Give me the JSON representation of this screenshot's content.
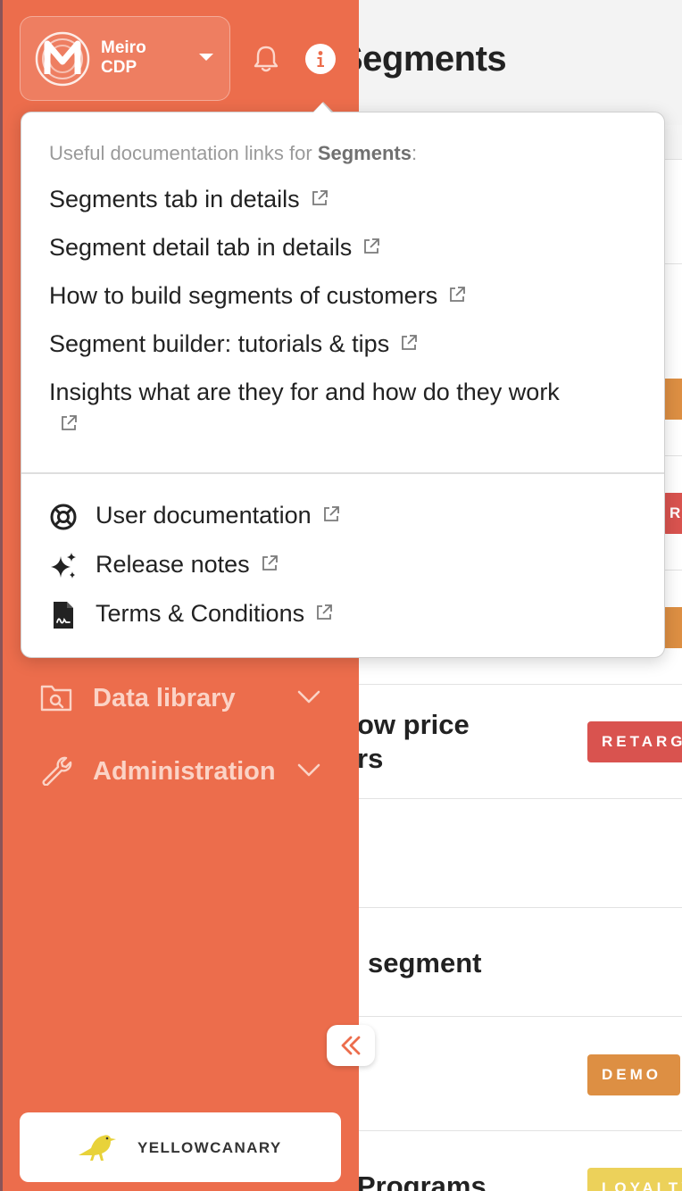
{
  "brand": {
    "name_line1": "Meiro",
    "name_line2": "CDP"
  },
  "main": {
    "page_title": "Segments",
    "rows": [
      {
        "title_line1": "ow price",
        "title_line2": "rs",
        "tag": "RETARGETING",
        "tag_color": "#d9534f"
      },
      {
        "title_line1": "segment"
      },
      {
        "tag": "DEMO",
        "tag_color": "#dd8f43"
      },
      {
        "title_line1": "Programs",
        "tag": "LOYALTY",
        "tag_color": "#ecd15a"
      }
    ],
    "partial_tags": [
      {
        "tag": "",
        "tag_color": "#dd8f43"
      },
      {
        "tag": "RG",
        "tag_color": "#d9534f"
      },
      {
        "tag": "",
        "tag_color": "#dd8f43"
      }
    ]
  },
  "popover": {
    "intro_prefix": "Useful documentation links for ",
    "intro_bold": "Segments",
    "intro_suffix": ":",
    "links": [
      "Segments tab in details",
      "Segment detail tab in details",
      "How to build segments of customers",
      "Segment builder: tutorials & tips",
      "Insights what are they for and how do they work"
    ],
    "bottom_links": [
      {
        "label": "User documentation",
        "icon": "lifebuoy-icon"
      },
      {
        "label": "Release notes",
        "icon": "sparkles-icon"
      },
      {
        "label": "Terms & Conditions",
        "icon": "file-contract-icon"
      }
    ]
  },
  "nav": [
    {
      "label": "Data library",
      "icon": "folder-search-icon"
    },
    {
      "label": "Administration",
      "icon": "wrench-icon"
    }
  ],
  "org": {
    "name": "YELLOWCANARY"
  },
  "colors": {
    "sidebar": "#ec6d4c",
    "accent_text": "#fbd3c6",
    "canary": "#e8d23a"
  }
}
